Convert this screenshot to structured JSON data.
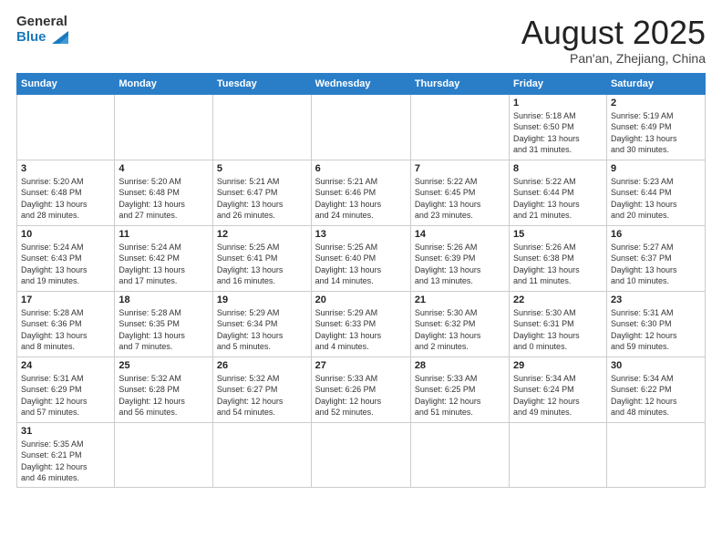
{
  "header": {
    "logo_general": "General",
    "logo_blue": "Blue",
    "month_title": "August 2025",
    "subtitle": "Pan'an, Zhejiang, China"
  },
  "days_of_week": [
    "Sunday",
    "Monday",
    "Tuesday",
    "Wednesday",
    "Thursday",
    "Friday",
    "Saturday"
  ],
  "weeks": [
    [
      {
        "day": "",
        "info": ""
      },
      {
        "day": "",
        "info": ""
      },
      {
        "day": "",
        "info": ""
      },
      {
        "day": "",
        "info": ""
      },
      {
        "day": "",
        "info": ""
      },
      {
        "day": "1",
        "info": "Sunrise: 5:18 AM\nSunset: 6:50 PM\nDaylight: 13 hours\nand 31 minutes."
      },
      {
        "day": "2",
        "info": "Sunrise: 5:19 AM\nSunset: 6:49 PM\nDaylight: 13 hours\nand 30 minutes."
      }
    ],
    [
      {
        "day": "3",
        "info": "Sunrise: 5:20 AM\nSunset: 6:48 PM\nDaylight: 13 hours\nand 28 minutes."
      },
      {
        "day": "4",
        "info": "Sunrise: 5:20 AM\nSunset: 6:48 PM\nDaylight: 13 hours\nand 27 minutes."
      },
      {
        "day": "5",
        "info": "Sunrise: 5:21 AM\nSunset: 6:47 PM\nDaylight: 13 hours\nand 26 minutes."
      },
      {
        "day": "6",
        "info": "Sunrise: 5:21 AM\nSunset: 6:46 PM\nDaylight: 13 hours\nand 24 minutes."
      },
      {
        "day": "7",
        "info": "Sunrise: 5:22 AM\nSunset: 6:45 PM\nDaylight: 13 hours\nand 23 minutes."
      },
      {
        "day": "8",
        "info": "Sunrise: 5:22 AM\nSunset: 6:44 PM\nDaylight: 13 hours\nand 21 minutes."
      },
      {
        "day": "9",
        "info": "Sunrise: 5:23 AM\nSunset: 6:44 PM\nDaylight: 13 hours\nand 20 minutes."
      }
    ],
    [
      {
        "day": "10",
        "info": "Sunrise: 5:24 AM\nSunset: 6:43 PM\nDaylight: 13 hours\nand 19 minutes."
      },
      {
        "day": "11",
        "info": "Sunrise: 5:24 AM\nSunset: 6:42 PM\nDaylight: 13 hours\nand 17 minutes."
      },
      {
        "day": "12",
        "info": "Sunrise: 5:25 AM\nSunset: 6:41 PM\nDaylight: 13 hours\nand 16 minutes."
      },
      {
        "day": "13",
        "info": "Sunrise: 5:25 AM\nSunset: 6:40 PM\nDaylight: 13 hours\nand 14 minutes."
      },
      {
        "day": "14",
        "info": "Sunrise: 5:26 AM\nSunset: 6:39 PM\nDaylight: 13 hours\nand 13 minutes."
      },
      {
        "day": "15",
        "info": "Sunrise: 5:26 AM\nSunset: 6:38 PM\nDaylight: 13 hours\nand 11 minutes."
      },
      {
        "day": "16",
        "info": "Sunrise: 5:27 AM\nSunset: 6:37 PM\nDaylight: 13 hours\nand 10 minutes."
      }
    ],
    [
      {
        "day": "17",
        "info": "Sunrise: 5:28 AM\nSunset: 6:36 PM\nDaylight: 13 hours\nand 8 minutes."
      },
      {
        "day": "18",
        "info": "Sunrise: 5:28 AM\nSunset: 6:35 PM\nDaylight: 13 hours\nand 7 minutes."
      },
      {
        "day": "19",
        "info": "Sunrise: 5:29 AM\nSunset: 6:34 PM\nDaylight: 13 hours\nand 5 minutes."
      },
      {
        "day": "20",
        "info": "Sunrise: 5:29 AM\nSunset: 6:33 PM\nDaylight: 13 hours\nand 4 minutes."
      },
      {
        "day": "21",
        "info": "Sunrise: 5:30 AM\nSunset: 6:32 PM\nDaylight: 13 hours\nand 2 minutes."
      },
      {
        "day": "22",
        "info": "Sunrise: 5:30 AM\nSunset: 6:31 PM\nDaylight: 13 hours\nand 0 minutes."
      },
      {
        "day": "23",
        "info": "Sunrise: 5:31 AM\nSunset: 6:30 PM\nDaylight: 12 hours\nand 59 minutes."
      }
    ],
    [
      {
        "day": "24",
        "info": "Sunrise: 5:31 AM\nSunset: 6:29 PM\nDaylight: 12 hours\nand 57 minutes."
      },
      {
        "day": "25",
        "info": "Sunrise: 5:32 AM\nSunset: 6:28 PM\nDaylight: 12 hours\nand 56 minutes."
      },
      {
        "day": "26",
        "info": "Sunrise: 5:32 AM\nSunset: 6:27 PM\nDaylight: 12 hours\nand 54 minutes."
      },
      {
        "day": "27",
        "info": "Sunrise: 5:33 AM\nSunset: 6:26 PM\nDaylight: 12 hours\nand 52 minutes."
      },
      {
        "day": "28",
        "info": "Sunrise: 5:33 AM\nSunset: 6:25 PM\nDaylight: 12 hours\nand 51 minutes."
      },
      {
        "day": "29",
        "info": "Sunrise: 5:34 AM\nSunset: 6:24 PM\nDaylight: 12 hours\nand 49 minutes."
      },
      {
        "day": "30",
        "info": "Sunrise: 5:34 AM\nSunset: 6:22 PM\nDaylight: 12 hours\nand 48 minutes."
      }
    ],
    [
      {
        "day": "31",
        "info": "Sunrise: 5:35 AM\nSunset: 6:21 PM\nDaylight: 12 hours\nand 46 minutes."
      },
      {
        "day": "",
        "info": ""
      },
      {
        "day": "",
        "info": ""
      },
      {
        "day": "",
        "info": ""
      },
      {
        "day": "",
        "info": ""
      },
      {
        "day": "",
        "info": ""
      },
      {
        "day": "",
        "info": ""
      }
    ]
  ]
}
